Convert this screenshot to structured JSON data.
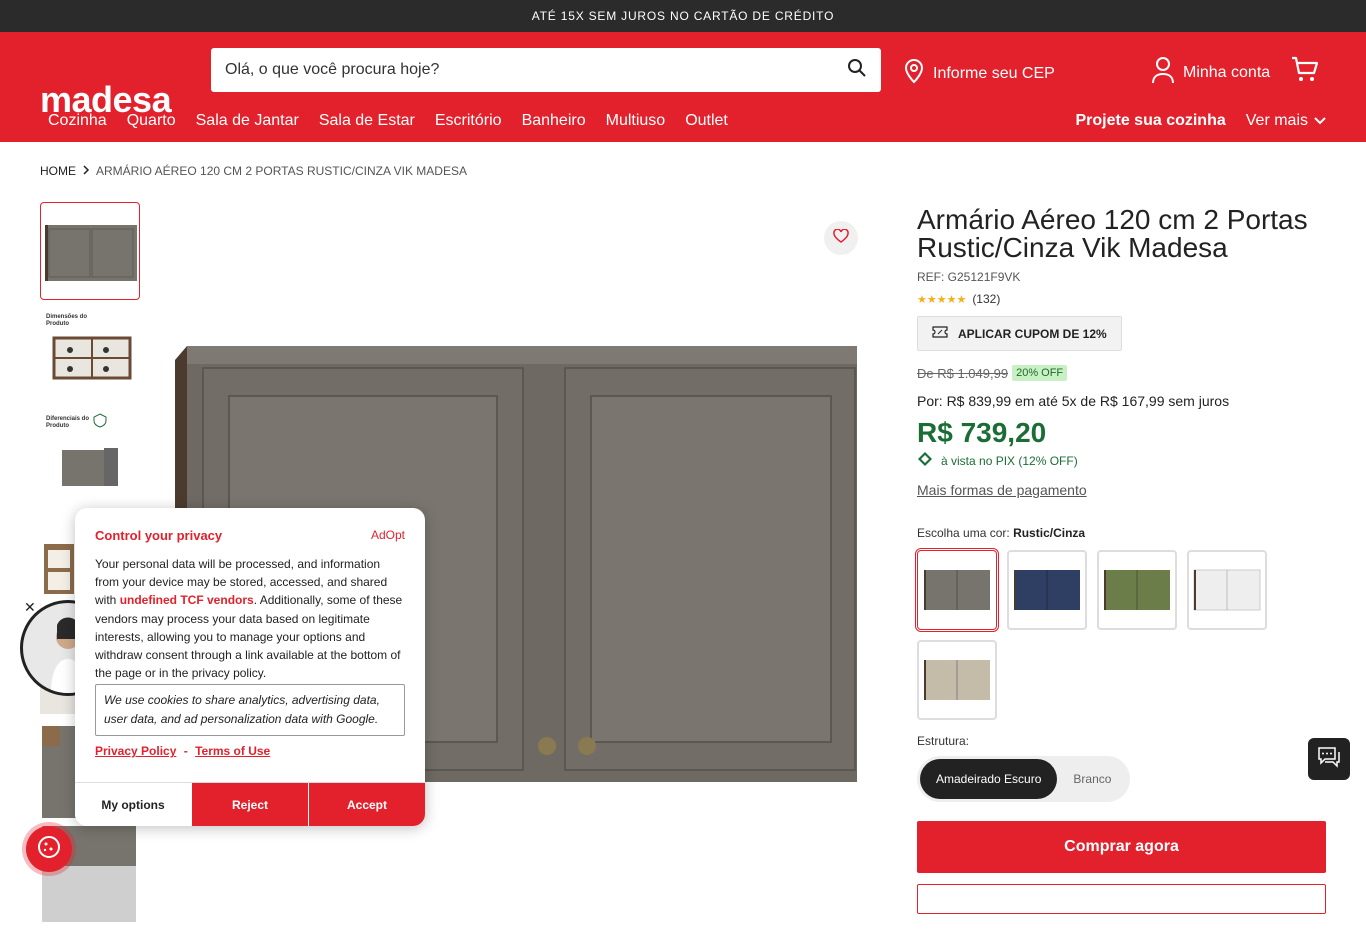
{
  "promo_bar": {
    "text": "ATÉ 15X SEM JUROS NO CARTÃO DE CRÉDITO"
  },
  "header": {
    "logo": "madesa",
    "search_placeholder": "Olá, o que você procura hoje?",
    "cep_label": "Informe seu CEP",
    "account_label": "Minha conta"
  },
  "nav": {
    "items": [
      "Cozinha",
      "Quarto",
      "Sala de Jantar",
      "Sala de Estar",
      "Escritório",
      "Banheiro",
      "Multiuso",
      "Outlet"
    ],
    "right": {
      "project": "Projete sua cozinha",
      "more": "Ver mais"
    }
  },
  "breadcrumb": {
    "home": "HOME",
    "current": "ARMÁRIO AÉREO 120 CM 2 PORTAS RUSTIC/CINZA VIK MADESA"
  },
  "thumbnails": {
    "t2_caption": "Dimensões do Produto",
    "t3_caption": "Diferenciais do Produto"
  },
  "product": {
    "title": "Armário Aéreo 120 cm 2 Portas Rustic/Cinza Vik Madesa",
    "ref": "REF: G25121F9VK",
    "rating_stars": 5,
    "rating_count": "(132)",
    "coupon": "APLICAR CUPOM DE 12%",
    "old_price": "De R$ 1.049,99",
    "discount_badge": "20% OFF",
    "installments": "Por: R$ 839,99 em até 5x de R$ 167,99 sem juros",
    "price": "R$ 739,20",
    "pix_note": "à vista no PIX (12% OFF)",
    "more_payment": "Mais formas de pagamento",
    "color_prefix": "Escolha uma cor:",
    "color_selected": "Rustic/Cinza",
    "swatch_colors": [
      "#77746d",
      "#2f3e63",
      "#6b7d48",
      "#eeeeee",
      "#c4bba9"
    ],
    "structure_label": "Estrutura:",
    "structure_options": [
      "Amadeirado Escuro",
      "Branco"
    ],
    "buy_button": "Comprar agora"
  },
  "privacy": {
    "title": "Control your privacy",
    "brand": "AdOpt",
    "body_1": "Your personal data will be processed, and information from your device may be stored, accessed, and shared with ",
    "vendors": "undefined TCF vendors",
    "body_2": ". Additionally, some of these vendors may process your data based on legitimate interests, allowing you to manage your options and withdraw consent through a link available at the bottom of the page or in the privacy policy.",
    "google_note": "We use cookies to share analytics, advertising data, user data, and ad personalization data with Google.",
    "privacy_policy": "Privacy Policy",
    "separator": "-",
    "terms": "Terms of Use",
    "btn_options": "My options",
    "btn_reject": "Reject",
    "btn_accept": "Accept"
  },
  "colors": {
    "brand_red": "#e3212c",
    "price_green": "#1a6e35",
    "dark": "#2b2b2b"
  }
}
